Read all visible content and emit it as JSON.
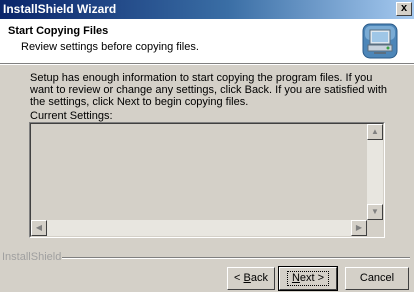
{
  "window": {
    "title": "InstallShield Wizard",
    "close_glyph": "x"
  },
  "header": {
    "title": "Start Copying Files",
    "subtitle": "Review settings before copying files.",
    "icon": "computer-setup-icon"
  },
  "body": {
    "description": "Setup has enough information to start copying the program files.  If you want to review or change any settings, click Back.  If you are satisfied with the settings, click Next to begin copying files.",
    "current_settings_label": "Current Settings:",
    "current_settings_value": ""
  },
  "footer": {
    "brand_label": "InstallShield"
  },
  "buttons": {
    "back_prefix": "< ",
    "back_key": "B",
    "back_rest": "ack",
    "next_key": "N",
    "next_rest": "ext >",
    "cancel": "Cancel"
  },
  "colors": {
    "title_bar_start": "#0a246a",
    "title_bar_end": "#a6caf0",
    "dialog_face": "#d4d0c8",
    "header_background": "#ffffff"
  }
}
